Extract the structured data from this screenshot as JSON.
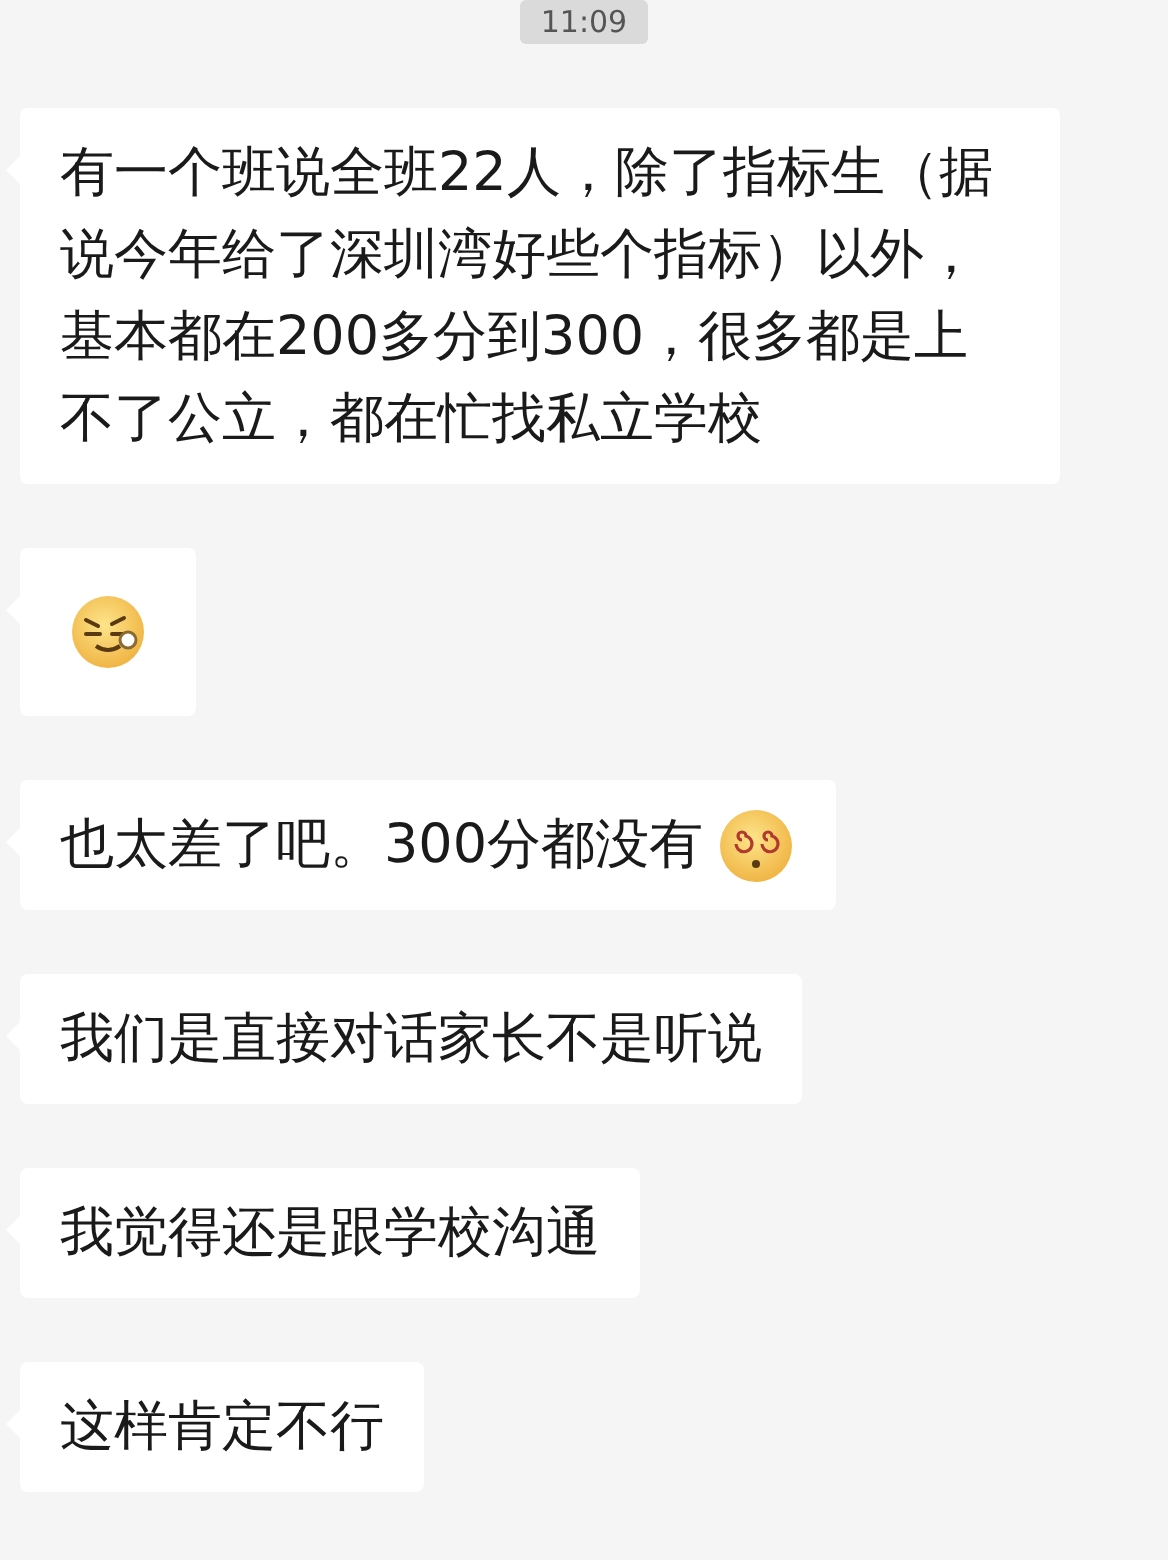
{
  "timestamp": "11:09",
  "messages": [
    {
      "parts": [
        {
          "kind": "text",
          "text": "有一个班说全班22人，除了指标生（据说今年给了深圳湾好些个指标）以外，基本都在200多分到300，很多都是上不了公立，都在忙找私立学校"
        }
      ]
    },
    {
      "parts": [
        {
          "kind": "smirk"
        }
      ]
    },
    {
      "parts": [
        {
          "kind": "text",
          "text": "也太差了吧。300分都没有"
        },
        {
          "kind": "dizzy"
        }
      ]
    },
    {
      "parts": [
        {
          "kind": "text",
          "text": "我们是直接对话家长不是听说"
        }
      ]
    },
    {
      "parts": [
        {
          "kind": "text",
          "text": "我觉得还是跟学校沟通"
        }
      ]
    },
    {
      "parts": [
        {
          "kind": "text",
          "text": "这样肯定不行"
        }
      ]
    }
  ]
}
